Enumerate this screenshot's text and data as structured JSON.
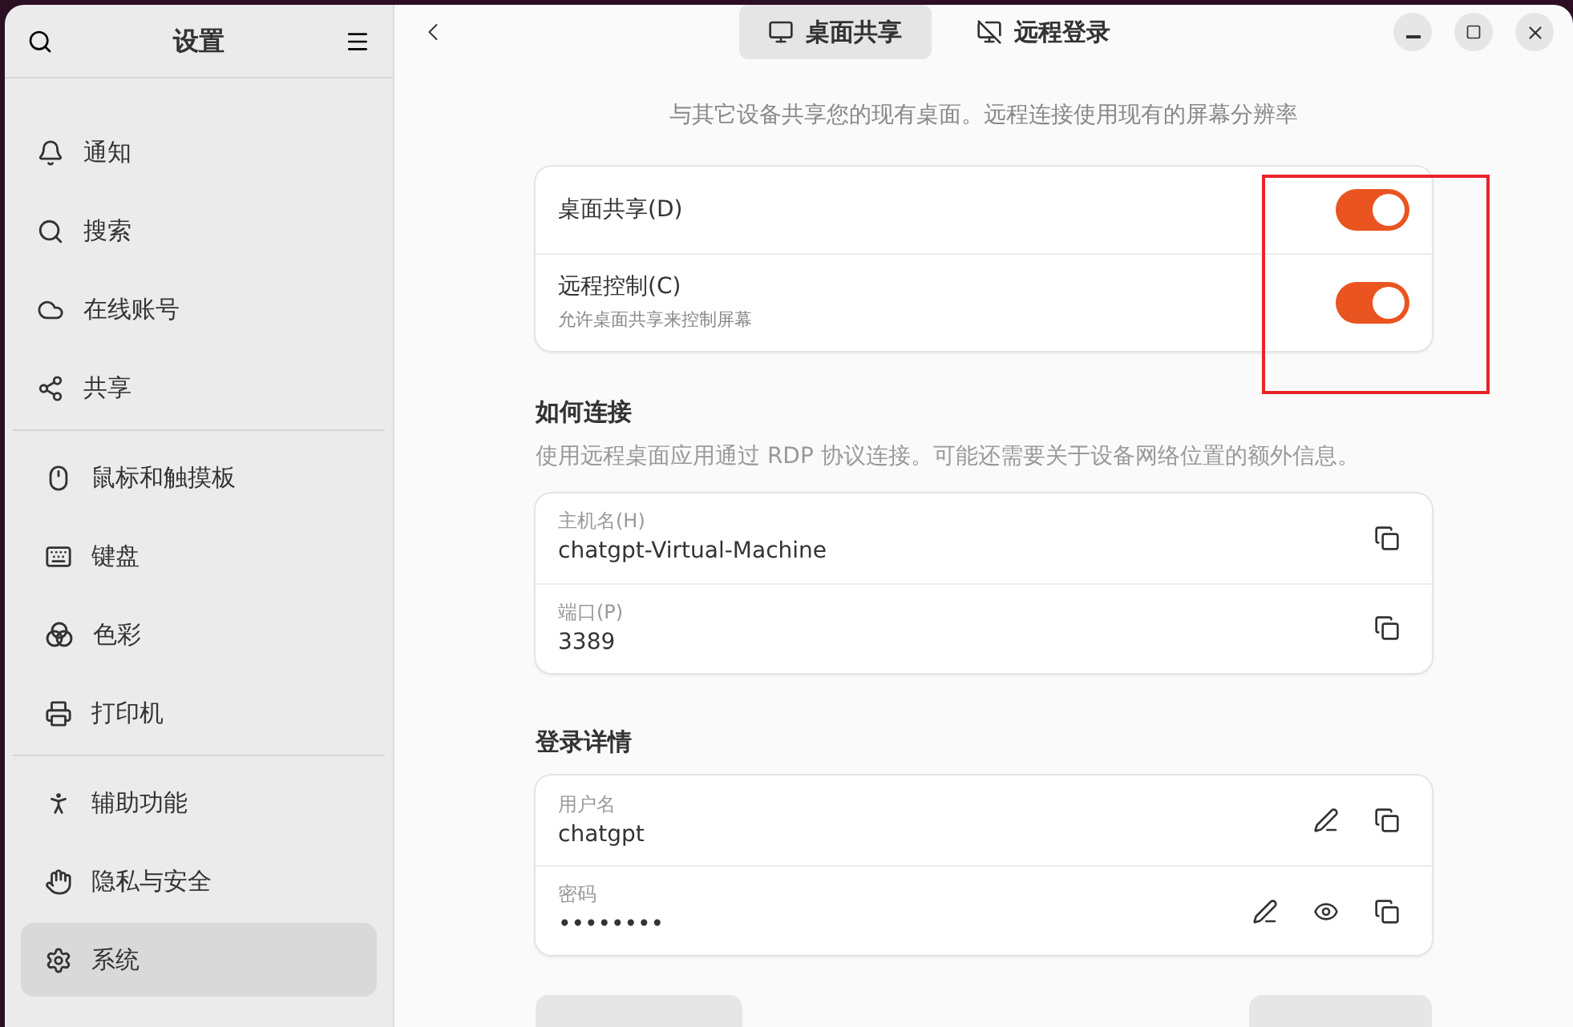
{
  "sidebar": {
    "title": "设置",
    "groups": [
      [
        {
          "label": "通知",
          "selected": false
        },
        {
          "label": "搜索",
          "selected": false
        },
        {
          "label": "在线账号",
          "selected": false
        },
        {
          "label": "共享",
          "selected": false
        }
      ],
      [
        {
          "label": "鼠标和触摸板",
          "selected": false
        },
        {
          "label": "键盘",
          "selected": false
        },
        {
          "label": "色彩",
          "selected": false
        },
        {
          "label": "打印机",
          "selected": false
        }
      ],
      [
        {
          "label": "辅助功能",
          "selected": false
        },
        {
          "label": "隐私与安全",
          "selected": false
        },
        {
          "label": "系统",
          "selected": true
        }
      ]
    ]
  },
  "tabs": [
    {
      "label": "桌面共享",
      "selected": true
    },
    {
      "label": "远程登录",
      "selected": false
    }
  ],
  "description": "与其它设备共享您的现有桌面。远程连接使用现有的屏幕分辨率",
  "toggles": [
    {
      "label": "桌面共享(D)",
      "on": true
    },
    {
      "label": "远程控制(C)",
      "subtitle": "允许桌面共享来控制屏幕",
      "on": true
    }
  ],
  "sections": [
    {
      "heading": "如何连接",
      "description": "使用远程桌面应用通过 RDP 协议连接。可能还需要关于设备网络位置的额外信息。",
      "fields": [
        {
          "kind": "copyable",
          "label": "主机名(H)",
          "value": "chatgpt-Virtual-Machine"
        },
        {
          "kind": "copyable",
          "label": "端口(P)",
          "value": "3389"
        }
      ]
    },
    {
      "heading": "登录详情",
      "fields": [
        {
          "kind": "editable",
          "label": "用户名",
          "value": "chatgpt"
        },
        {
          "kind": "secret",
          "label": "密码",
          "value": "••••••••"
        }
      ]
    }
  ]
}
